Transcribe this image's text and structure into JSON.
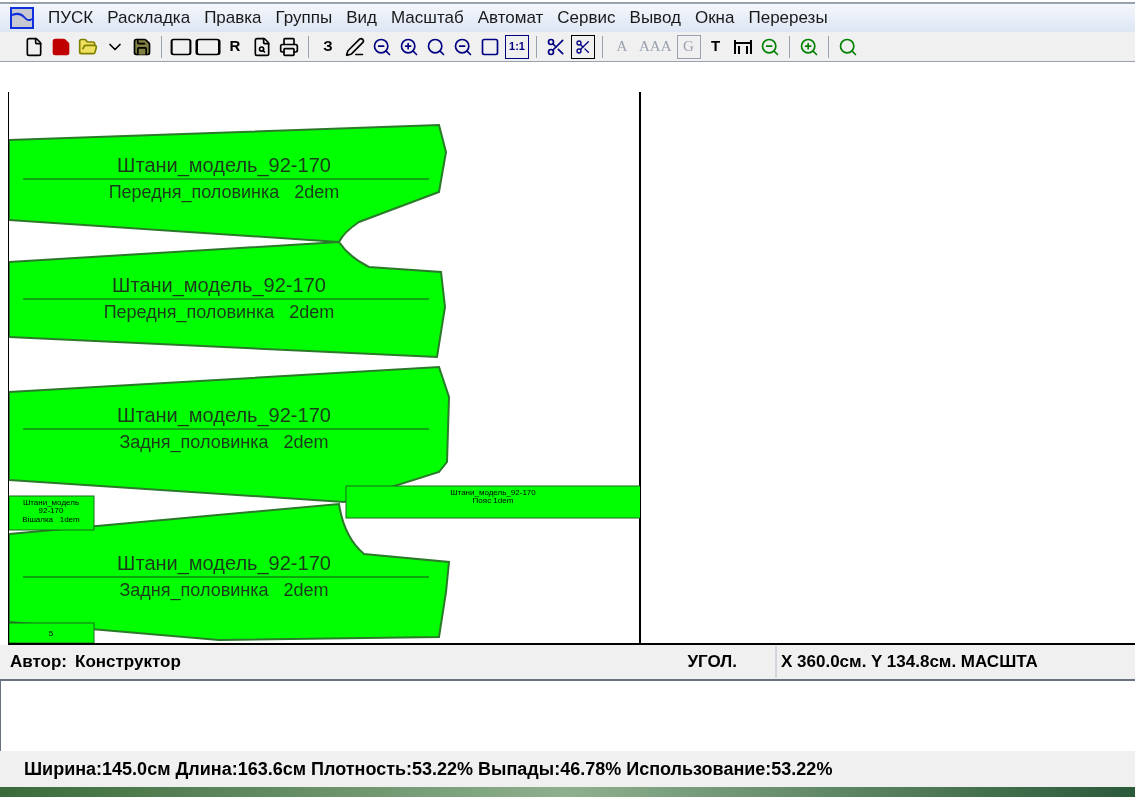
{
  "menu": [
    "ПУСК",
    "Раскладка",
    "Правка",
    "Группы",
    "Вид",
    "Масштаб",
    "Автомат",
    "Сервис",
    "Вывод",
    "Окна",
    "Перерезы"
  ],
  "toolbar": [
    {
      "kind": "new"
    },
    {
      "kind": "save-red"
    },
    {
      "kind": "open"
    },
    {
      "kind": "caret"
    },
    {
      "kind": "save"
    },
    {
      "kind": "sep"
    },
    {
      "kind": "frame"
    },
    {
      "kind": "frame-wide"
    },
    {
      "kind": "text",
      "label": "R",
      "disabled": false
    },
    {
      "kind": "preview"
    },
    {
      "kind": "print"
    },
    {
      "kind": "sep"
    },
    {
      "kind": "text",
      "label": "З",
      "disabled": false
    },
    {
      "kind": "pencil"
    },
    {
      "kind": "zoom-out"
    },
    {
      "kind": "zoom-in"
    },
    {
      "kind": "zoom-slash"
    },
    {
      "kind": "zoom-lines"
    },
    {
      "kind": "square"
    },
    {
      "kind": "text-box",
      "label": "1:1",
      "disabled": false
    },
    {
      "kind": "sep"
    },
    {
      "kind": "scissors"
    },
    {
      "kind": "scissors-box"
    },
    {
      "kind": "sep"
    },
    {
      "kind": "text",
      "label": "A",
      "disabled": true
    },
    {
      "kind": "text",
      "label": "AAA",
      "disabled": true
    },
    {
      "kind": "text-box",
      "label": "G",
      "disabled": true
    },
    {
      "kind": "text",
      "label": "T",
      "disabled": false
    },
    {
      "kind": "width"
    },
    {
      "kind": "zoom-out-green"
    },
    {
      "kind": "sep"
    },
    {
      "kind": "zoom-in-green"
    },
    {
      "kind": "sep"
    },
    {
      "kind": "zoom-slash-green"
    }
  ],
  "pieces": [
    {
      "kind": "front",
      "title": "Штани_модель_92-170",
      "subtitle": "Передня_половинка   2dem"
    },
    {
      "kind": "front2",
      "title": "Штани_модель_92-170",
      "subtitle": "Передня_половинка   2dem"
    },
    {
      "kind": "back",
      "title": "Штани_модель_92-170",
      "subtitle": "Задня_половинка   2dem"
    },
    {
      "kind": "back2",
      "title": "Штани_модель_92-170",
      "subtitle": "Задня_половинка   2dem"
    },
    {
      "kind": "belt",
      "title": "Штани_модель_92-170",
      "subtitle": "Пояс   1dem"
    },
    {
      "kind": "small",
      "title": "Штани_модель",
      "subtitle": "92-170",
      "note": "Вішалка   1dem"
    },
    {
      "kind": "tiny",
      "title": "5"
    }
  ],
  "status": {
    "author_label": "Автор:",
    "author": "Конструктор",
    "mode": "УГОЛ.",
    "coords": "X 360.0см.  Y 134.8см. МАСШТА"
  },
  "summary": "Ширина:145.0см Длина:163.6см Плотность:53.22% Выпады:46.78% Использование:53.22%"
}
